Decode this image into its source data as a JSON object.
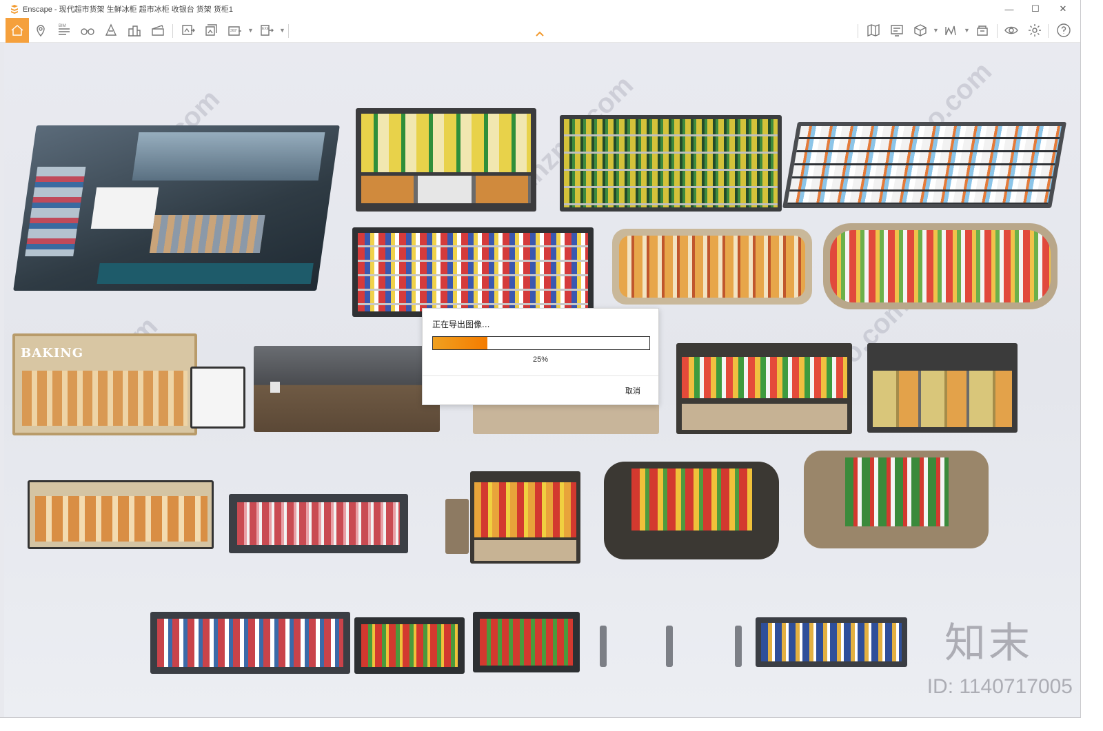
{
  "titlebar": {
    "title": "Enscape - 现代超市货架 生鲜冰柜 超市冰柜 收银台 货架 货柜1",
    "minimize": "—",
    "maximize": "☐",
    "close": "✕"
  },
  "toolbar": {
    "left_icons": [
      "home-icon",
      "location-pin-icon",
      "bim-icon",
      "binoculars-icon",
      "cone-icon",
      "buildings-icon",
      "clapperboard-icon",
      "export-image-icon",
      "batch-render-icon",
      "panorama-360-icon",
      "export-exe-icon"
    ],
    "right_icons": [
      "map-icon",
      "screen-icon",
      "cube-icon",
      "chart-icon",
      "asset-library-icon",
      "eye-icon",
      "gear-icon",
      "help-icon"
    ],
    "bim_label": "BIM",
    "pano_label": "360°",
    "exe_label": "EXE"
  },
  "scene": {
    "sign_text": "BAKING",
    "watermark_site": "znzmo.com",
    "brand": "知末",
    "id_text": "ID: 1140717005"
  },
  "dialog": {
    "title": "正在导出图像...",
    "progress": 0.25,
    "percent_text": "25%",
    "cancel_label": "取消",
    "fill_color": "#f47c00"
  }
}
